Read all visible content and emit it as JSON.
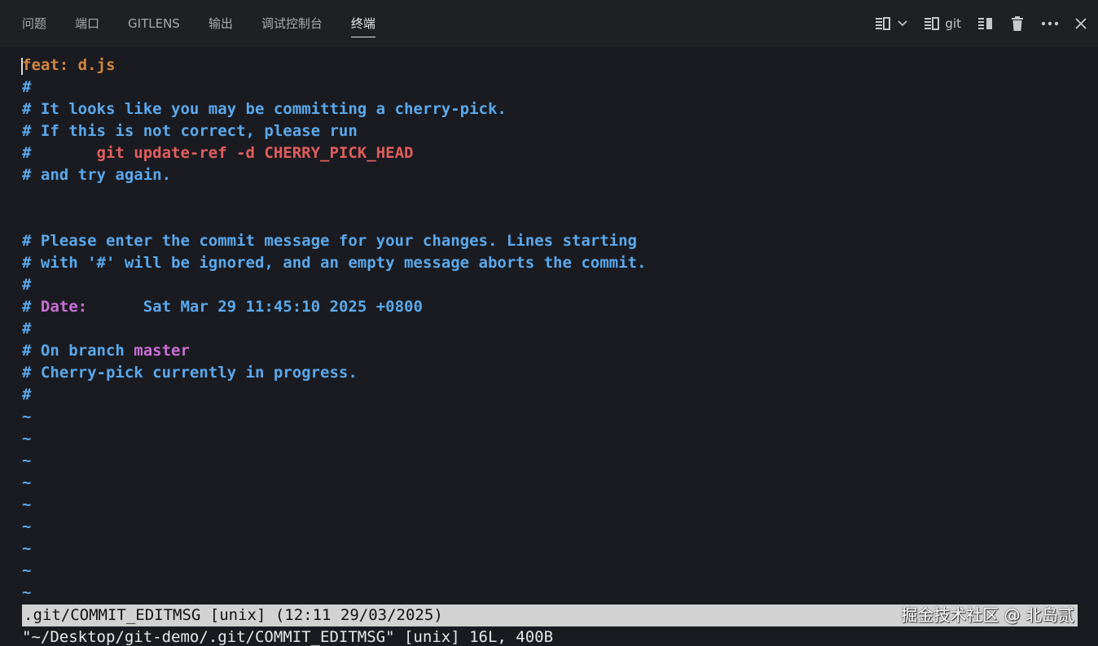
{
  "tabs": [
    {
      "label": "问题"
    },
    {
      "label": "端口"
    },
    {
      "label": "GITLENS"
    },
    {
      "label": "输出"
    },
    {
      "label": "调试控制台"
    },
    {
      "label": "终端",
      "active": true
    }
  ],
  "toolbar": {
    "terminal_name": "git",
    "icons": [
      "split-terminal-icon",
      "chevron-down-icon",
      "terminal-icon",
      "split-editor-icon",
      "trash-icon",
      "more-icon",
      "close-icon"
    ]
  },
  "editor": {
    "lines": [
      {
        "segments": [
          {
            "text": "feat: d.js",
            "style": "subject"
          }
        ],
        "cursor": true
      },
      {
        "segments": [
          {
            "text": "#",
            "style": "comment"
          }
        ]
      },
      {
        "segments": [
          {
            "text": "# It looks like you may be committing a cherry-pick.",
            "style": "comment"
          }
        ]
      },
      {
        "segments": [
          {
            "text": "# If this is not correct, please run",
            "style": "comment"
          }
        ]
      },
      {
        "segments": [
          {
            "text": "#       ",
            "style": "comment"
          },
          {
            "text": "git update-ref -d CHERRY_PICK_HEAD",
            "style": "red"
          }
        ]
      },
      {
        "segments": [
          {
            "text": "# and try again.",
            "style": "comment"
          }
        ]
      },
      {
        "segments": []
      },
      {
        "segments": []
      },
      {
        "segments": [
          {
            "text": "# Please enter the commit message for your changes. Lines starting",
            "style": "comment"
          }
        ]
      },
      {
        "segments": [
          {
            "text": "# with '#' will be ignored, and an empty message aborts the commit.",
            "style": "comment"
          }
        ]
      },
      {
        "segments": [
          {
            "text": "#",
            "style": "comment"
          }
        ]
      },
      {
        "segments": [
          {
            "text": "# ",
            "style": "comment"
          },
          {
            "text": "Date:",
            "style": "purple"
          },
          {
            "text": "      Sat Mar 29 11:45:10 2025 +0800",
            "style": "comment"
          }
        ]
      },
      {
        "segments": [
          {
            "text": "#",
            "style": "comment"
          }
        ]
      },
      {
        "segments": [
          {
            "text": "# On branch ",
            "style": "comment"
          },
          {
            "text": "master",
            "style": "purple"
          }
        ]
      },
      {
        "segments": [
          {
            "text": "# Cherry-pick currently in progress.",
            "style": "comment"
          }
        ]
      },
      {
        "segments": [
          {
            "text": "#",
            "style": "comment"
          }
        ]
      },
      {
        "segments": [
          {
            "text": "~",
            "style": "tilde"
          }
        ]
      },
      {
        "segments": [
          {
            "text": "~",
            "style": "tilde"
          }
        ]
      },
      {
        "segments": [
          {
            "text": "~",
            "style": "tilde"
          }
        ]
      },
      {
        "segments": [
          {
            "text": "~",
            "style": "tilde"
          }
        ]
      },
      {
        "segments": [
          {
            "text": "~",
            "style": "tilde"
          }
        ]
      },
      {
        "segments": [
          {
            "text": "~",
            "style": "tilde"
          }
        ]
      },
      {
        "segments": [
          {
            "text": "~",
            "style": "tilde"
          }
        ]
      },
      {
        "segments": [
          {
            "text": "~",
            "style": "tilde"
          }
        ]
      },
      {
        "segments": [
          {
            "text": "~",
            "style": "tilde"
          }
        ]
      }
    ]
  },
  "status": {
    "file_info": ".git/COMMIT_EDITMSG [unix] (12:11 29/03/2025)",
    "watermark": "掘金技术社区 @ 北岛贰"
  },
  "cmdline": {
    "text": "\"~/Desktop/git-demo/.git/COMMIT_EDITMSG\" [unix] 16L, 400B"
  },
  "colors": {
    "background": "#1a1b20",
    "comment": "#5aa8ec",
    "subject": "#d1853f",
    "red": "#e25d5d",
    "purple": "#c96fd6",
    "statusbar": "#d2d2d2"
  }
}
